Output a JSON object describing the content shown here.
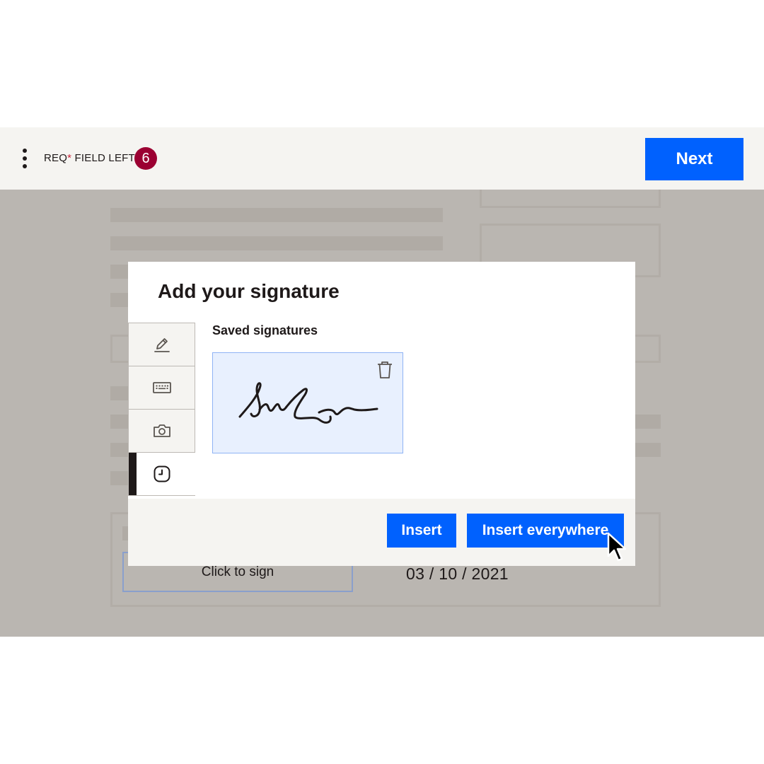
{
  "topbar": {
    "req_prefix": "REQ",
    "req_star": "*",
    "req_suffix": " FIELD LEFT",
    "fields_left_count": "6",
    "next_label": "Next",
    "menu_icon": "kebab-menu-icon"
  },
  "document": {
    "click_to_sign": "Click to sign",
    "date_value": "03 / 10 / 2021"
  },
  "modal": {
    "title": "Add your signature",
    "tabs": [
      {
        "icon": "pen-icon",
        "name": "draw"
      },
      {
        "icon": "keyboard-icon",
        "name": "type"
      },
      {
        "icon": "camera-icon",
        "name": "upload"
      },
      {
        "icon": "clock-icon",
        "name": "saved",
        "active": true
      }
    ],
    "saved_label": "Saved signatures",
    "insert_label": "Insert",
    "insert_everywhere_label": "Insert everywhere"
  },
  "colors": {
    "accent": "#0061fe",
    "badge": "#9b0032",
    "overlay": "#bab6b1",
    "topbar_bg": "#f5f4f1",
    "signature_card_bg": "#e8f0fe"
  }
}
